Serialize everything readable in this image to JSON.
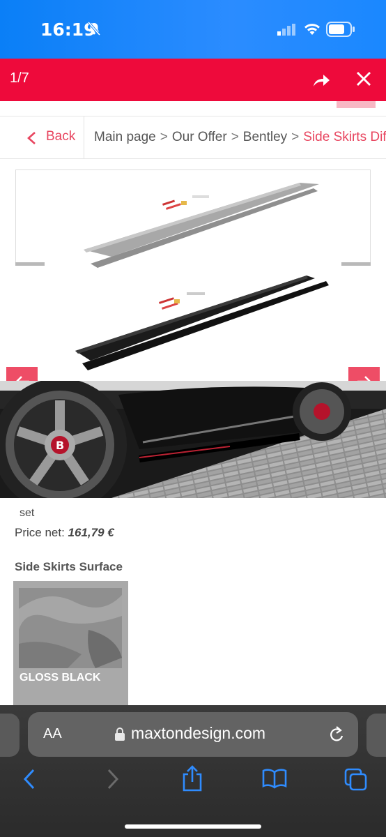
{
  "status_bar": {
    "time": "16:19"
  },
  "lightbox": {
    "counter": "1/7"
  },
  "breadcrumb": {
    "back_label": "Back",
    "items": [
      "Main page",
      "Our Offer",
      "Bentley"
    ],
    "current": "Side Skirts Diffu"
  },
  "product": {
    "unit": "set",
    "price_label": "Price net:",
    "price_value": "161,79 €",
    "surface_title": "Side Skirts Surface",
    "surface_option": "GLOSS BLACK"
  },
  "browser": {
    "aa_label": "AA",
    "domain": "maxtondesign.com"
  },
  "colors": {
    "brand_red": "#ee0a3b",
    "accent_pink": "#ee4d66",
    "ios_blue": "#0a7ff7"
  }
}
